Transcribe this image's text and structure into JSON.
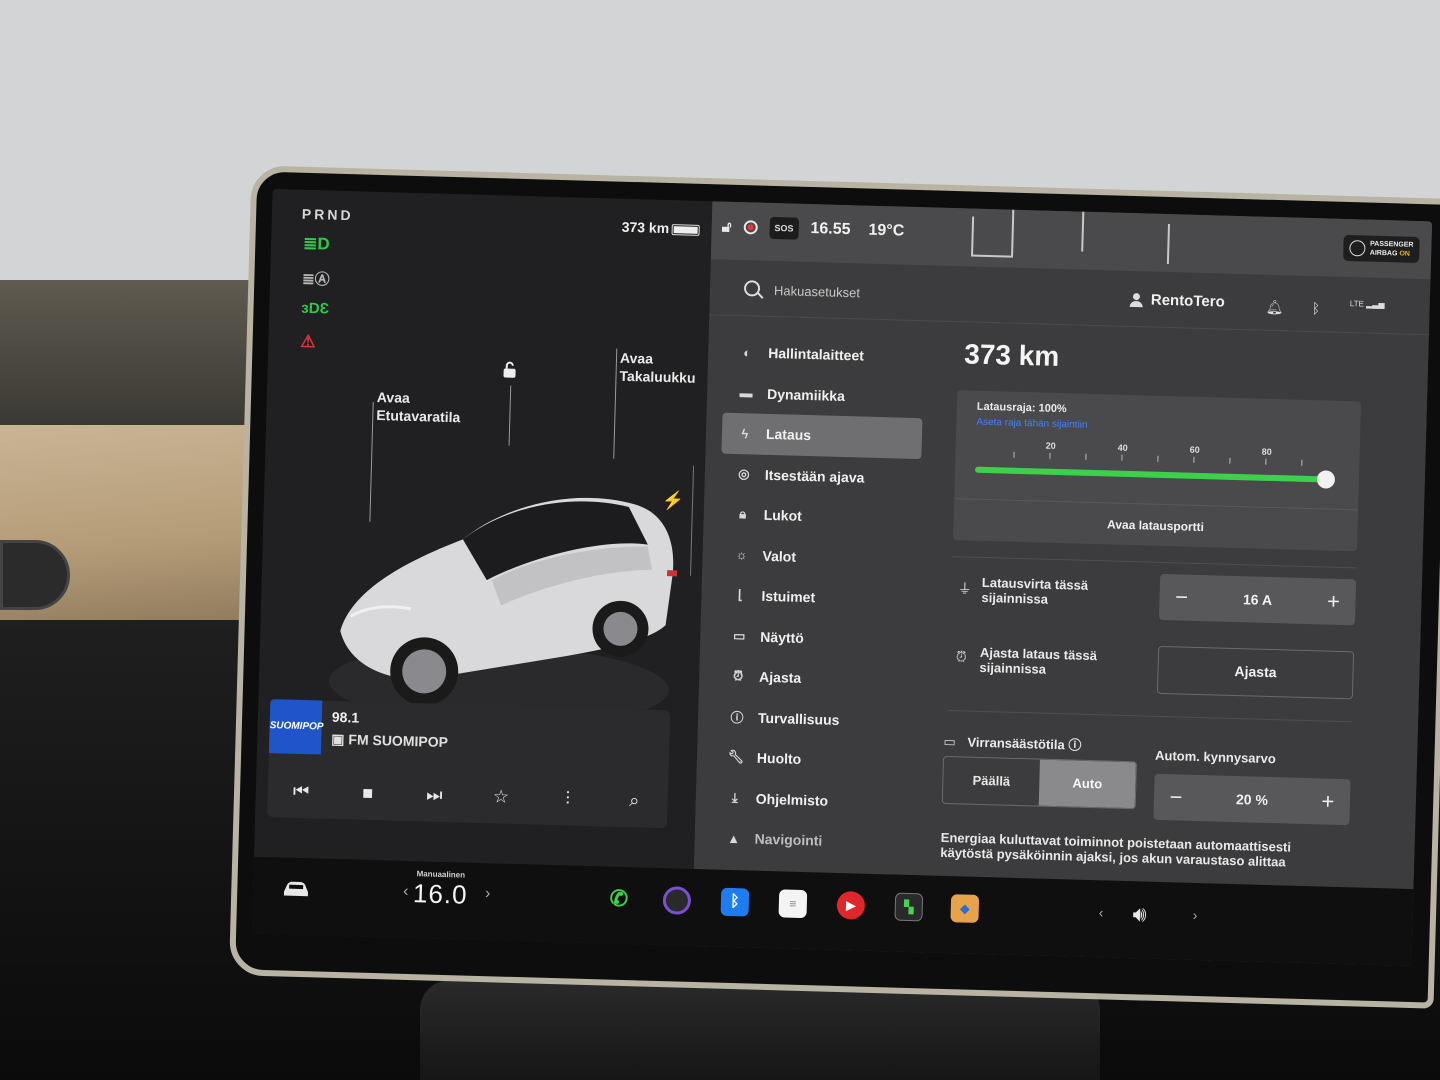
{
  "drive": {
    "gears": "PRND",
    "range": "373 km"
  },
  "car_view": {
    "frunk_callout": [
      "Avaa",
      "Etutavaratila"
    ],
    "trunk_callout": [
      "Avaa",
      "Takaluukku"
    ]
  },
  "media": {
    "frequency": "98.1",
    "station": "FM SUOMIPOP",
    "art_label": "SUOMIPOP"
  },
  "status_bar": {
    "sos": "SOS",
    "time": "16.55",
    "temperature": "19°C",
    "airbag_line1": "PASSENGER",
    "airbag_line2": "AIRBAG",
    "airbag_state": "ON"
  },
  "header": {
    "search_placeholder": "Hakuasetukset",
    "user": "RentoTero",
    "network": "LTE"
  },
  "menu": {
    "items": [
      {
        "label": "Hallintalaitteet",
        "icon": "toggle-icon",
        "active": false
      },
      {
        "label": "Dynamiikka",
        "icon": "car-icon",
        "active": false
      },
      {
        "label": "Lataus",
        "icon": "bolt-icon",
        "active": true
      },
      {
        "label": "Itsestään ajava",
        "icon": "steering-wheel-icon",
        "active": false
      },
      {
        "label": "Lukot",
        "icon": "lock-icon",
        "active": false
      },
      {
        "label": "Valot",
        "icon": "light-icon",
        "active": false
      },
      {
        "label": "Istuimet",
        "icon": "seat-icon",
        "active": false
      },
      {
        "label": "Näyttö",
        "icon": "display-icon",
        "active": false
      },
      {
        "label": "Ajasta",
        "icon": "alarm-icon",
        "active": false
      },
      {
        "label": "Turvallisuus",
        "icon": "warning-icon",
        "active": false
      },
      {
        "label": "Huolto",
        "icon": "wrench-icon",
        "active": false
      },
      {
        "label": "Ohjelmisto",
        "icon": "download-icon",
        "active": false
      },
      {
        "label": "Navigointi",
        "icon": "navigation-icon",
        "active": false
      }
    ]
  },
  "charging": {
    "range": "373 km",
    "limit_label": "Latausraja: 100%",
    "limit_link": "Aseta raja tähän sijaintiin",
    "limit_value_percent": 100,
    "ticks": [
      "20",
      "40",
      "60",
      "80"
    ],
    "open_port": "Avaa latausportti",
    "current_label": "Latausvirta tässä sijainnissa",
    "current_value": "16 A",
    "schedule_label": "Ajasta lataus tässä sijainnissa",
    "schedule_button": "Ajasta",
    "saver_label": "Virransäästötila",
    "saver_options": [
      "Päällä",
      "Auto"
    ],
    "saver_selected": "Auto",
    "threshold_label": "Autom. kynnysarvo",
    "threshold_value": "20 %",
    "saver_note": "Energiaa kuluttavat toiminnot poistetaan automaattisesti käytöstä pysäköinnin ajaksi, jos akun varaustaso alittaa"
  },
  "dock": {
    "climate_mode": "Manuaalinen",
    "climate_temp": "16.0",
    "apps": [
      "phone-icon",
      "camera-icon",
      "bluetooth-icon",
      "notepad-icon",
      "music-icon",
      "toybox-icon",
      "games-icon"
    ]
  },
  "colors": {
    "active_menu": "#6f6f72",
    "slider_fill": "#3bd14a",
    "link": "#3e83ff",
    "airbag_on": "#f2b01e"
  }
}
